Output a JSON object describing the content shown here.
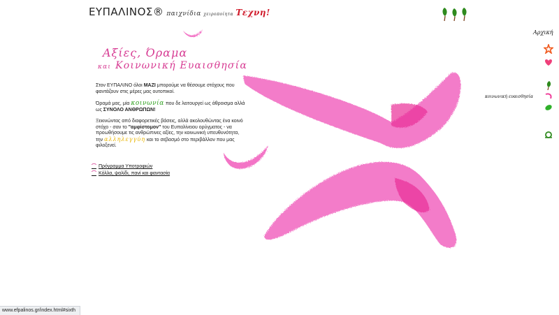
{
  "header": {
    "logo_text": "ΕΥΠΑΛΙΝΟΣ®",
    "tagline_prefix": "παιχνίδια",
    "tagline_small": "χειροποίητα",
    "tagline_brand": "Τεχνη!"
  },
  "title": {
    "line1": "Αξίες, Όραμα",
    "kai": "και",
    "line2": "Κοινωνική Ευαισθησία"
  },
  "content": {
    "p1_a": "Στον ",
    "p1_brand": "ΕΥΠΑΛΙΝΟ",
    "p1_b": " όλοι ",
    "p1_bold": "ΜΑΖΙ",
    "p1_c": " μπορούμε να θέσουμε στόχους που φαντάζουν στις μέρες μας ουτοπικοί.",
    "p2_a": "Όραμά μας, μία ",
    "p2_hl": "κοινωνία",
    "p2_b": " που δε λειτουργεί ως άθροισμα αλλά ως ",
    "p2_bold": "ΣΥΝΟΛΟ ΑΝΘΡΩΠΩΝ!",
    "p3_a": "Ξεκινώντας από διαφορετικές βάσεις, αλλά ακολουθώντας ένα κοινό στόχο - σαν το ",
    "p3_bold": "\"αμφίστομον\"",
    "p3_b": " του Ευπαλίνειου ορύγματος - να προωθήσουμε τις ανθρώπινες αξίες, την κοινωνική υπευθυνότητα, την ",
    "p3_hl": "αλληλεγγύη",
    "p3_c": " και το σεβασμό στο περιβάλλον που μας φιλοξενεί."
  },
  "links": [
    {
      "label": "Πρόγραμμα Υποτροφιών"
    },
    {
      "label": "Κόλλα, ψαλίδι, πανί και φαντασία"
    }
  ],
  "nav": {
    "title": "Αρχική",
    "icons": [
      "star-icon",
      "heart-icon",
      "leaf-icon",
      "swirl-icon",
      "green-leaf-icon",
      "snail-icon"
    ],
    "label": "κοινωνική ευαισθησία"
  },
  "status_bar": {
    "url": "www.efpalinos.gr/index.html#sixth"
  },
  "colors": {
    "accent_pink": "#d73c93",
    "brush_pink": "#f266c0",
    "green": "#30a020",
    "yellow": "#e8b400",
    "brand_red": "#d01a2a"
  }
}
